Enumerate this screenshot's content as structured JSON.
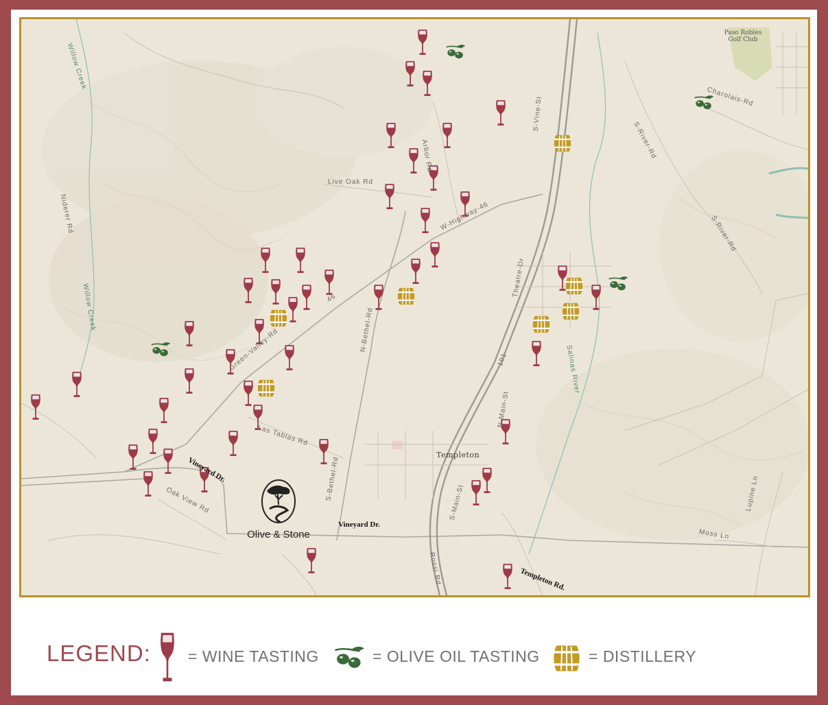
{
  "colors": {
    "wine": "#9e3b49",
    "olive": "#3b6a3a",
    "barrel": "#c49a26",
    "frame": "#b8912b",
    "border": "#9e4a4e",
    "map_bg": "#ece6d8"
  },
  "map": {
    "wine_icon": "wine-glass-icon",
    "olive_icon": "olive-branch-icon",
    "barrel_icon": "barrel-icon",
    "labels": {
      "willow_creek_1": "Willow Creek",
      "willow_creek_2": "Willow Creek",
      "niderer_rd": "Niderer Rd",
      "live_oak_rd": "Live Oak Rd",
      "arbor_rd": "Arbor Rd",
      "w_highway_46": "W-Highway-46",
      "hwy_46": "46",
      "green_valley_rd": "Green-Valley-Rd",
      "n_bethel_rd": "N-Bethel-Rd",
      "s_bethel_rd": "S-Bethel-Rd",
      "las_tablas_rd": "Las Tablas Rd",
      "oak_view_rd": "Oak View Rd",
      "vineyard_dr_1": "Vineyard Dr.",
      "vineyard_dr_2": "Vineyard Dr.",
      "templeton": "Templeton",
      "templeton_rd": "Templeton Rd.",
      "theatre_dr": "Theatre-Dr",
      "s_vine_st": "S-Vine-St",
      "salinas_river": "Salinas River",
      "s_river_rd_1": "S-River-Rd",
      "s_river_rd_2": "S-River-Rd",
      "charolais_rd": "Charolais-Rd",
      "paso_robles_golf_club": "Paso Robles Golf Club",
      "hwy_101": "101",
      "n_main_st": "N-Main-St",
      "s_main_st": "S-Main-St",
      "rossi_rd": "Rossi Rd",
      "moss_ln": "Moss Ln",
      "lupine_ln": "Lupine Ln"
    },
    "brand_name": "Olive & Stone"
  },
  "legend": {
    "title": "LEGEND:",
    "wine": "= WINE TASTING",
    "olive": "= OLIVE OIL TASTING",
    "distillery": "= DISTILLERY"
  }
}
